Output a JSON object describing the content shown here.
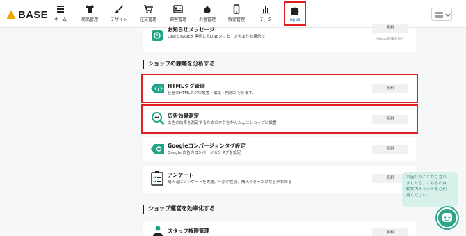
{
  "brand": {
    "name": "BASE",
    "accent": "#f0a500"
  },
  "nav": {
    "items": [
      {
        "label": "ホーム",
        "icon": "menu-icon"
      },
      {
        "label": "商品管理",
        "icon": "shirt-icon"
      },
      {
        "label": "デザイン",
        "icon": "design-brush-icon"
      },
      {
        "label": "注文管理",
        "icon": "cart-icon"
      },
      {
        "label": "顧客管理",
        "icon": "customer-card-icon"
      },
      {
        "label": "お金管理",
        "icon": "money-bag-icon"
      },
      {
        "label": "販促管理",
        "icon": "smartphone-icon"
      },
      {
        "label": "データ",
        "icon": "bar-chart-icon"
      },
      {
        "label": "Apps",
        "icon": "puzzle-icon",
        "highlighted": true
      }
    ]
  },
  "line_app": {
    "title": "お知らせメッセージ",
    "description": "LINEとBASEを連携してLINEメッセージをより効果的に",
    "price": "無料",
    "note": "※Apps内課金あり"
  },
  "sections": {
    "analyze": "ショップの課題を分析する",
    "efficiency": "ショップ運営を効率化する"
  },
  "apps": [
    {
      "title": "HTMLタグ管理",
      "description": "任意のHTMLタグの設置・編集・削除ができます。",
      "price": "無料",
      "icon": "html-tag-icon",
      "highlighted": true
    },
    {
      "title": "広告効果測定",
      "description": "広告の効果を測定するためのタグをかんたんにショップに設置",
      "price": "無料",
      "icon": "analytics-magnifier-icon",
      "highlighted": true
    },
    {
      "title": "Googleコンバージョンタグ設定",
      "description": "Google 広告のコンバージョンタグを設定",
      "price": "無料",
      "icon": "google-tag-icon"
    },
    {
      "title": "アンケート",
      "description": "購入者にアンケートを実施。年齢や性別、購入のきっかけなどがわかる",
      "price": "無料",
      "icon": "survey-clipboard-icon"
    },
    {
      "title": "スタッフ権限管理",
      "description": "",
      "price": "無料",
      "icon": "staff-icon"
    }
  ],
  "chat": {
    "lines": [
      "お困りのことがござい",
      "ましたら、こちらの自",
      "動案内チャットをご利",
      "用ください。"
    ]
  },
  "colors": {
    "highlight": "#e02020",
    "icon_green": "#1fa386",
    "chat_bg": "#d8f0ea",
    "chat_button": "#2fa58c"
  }
}
